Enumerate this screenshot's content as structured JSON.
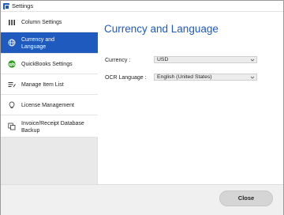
{
  "window": {
    "title": "Settings"
  },
  "sidebar": {
    "items": [
      {
        "label": "Column Settings",
        "icon": "column-bars-icon"
      },
      {
        "label": "Currency and Language",
        "icon": "globe-icon"
      },
      {
        "label": "QuickBooks Settings",
        "icon": "quickbooks-icon"
      },
      {
        "label": "Manage Item List",
        "icon": "list-edit-icon"
      },
      {
        "label": "License Management",
        "icon": "lightbulb-icon"
      },
      {
        "label": "Invoice/Receipt Database Backup",
        "icon": "database-backup-icon"
      }
    ],
    "active_index": 1
  },
  "main": {
    "title": "Currency and Language",
    "currency_label": "Currency :",
    "currency_value": "USD",
    "ocr_label": "OCR Language :",
    "ocr_value": "English (United States)"
  },
  "footer": {
    "close_label": "Close"
  },
  "colors": {
    "accent": "#1f5bbf",
    "quickbooks_green": "#2ca01c"
  }
}
